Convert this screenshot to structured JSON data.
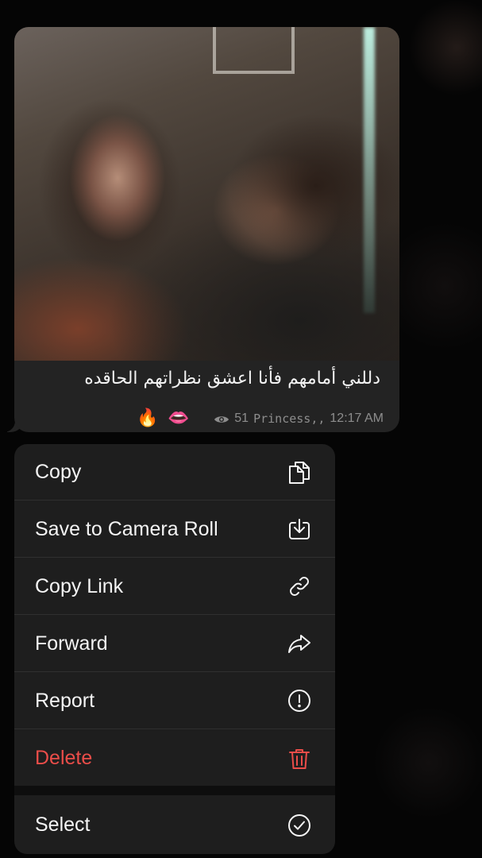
{
  "message": {
    "caption": "دللني أمامهم  فأنا اعشق نظراتهم الحاقده",
    "emojis": [
      "🔥",
      "👄"
    ],
    "views": "51",
    "author": "Princess,,",
    "time": "12:17 AM",
    "icons": {
      "views": "eye-icon"
    }
  },
  "menu": {
    "items": [
      {
        "label": "Copy",
        "icon": "copy-icon"
      },
      {
        "label": "Save to Camera Roll",
        "icon": "download-icon"
      },
      {
        "label": "Copy Link",
        "icon": "link-icon"
      },
      {
        "label": "Forward",
        "icon": "forward-icon"
      },
      {
        "label": "Report",
        "icon": "report-icon"
      },
      {
        "label": "Delete",
        "icon": "trash-icon",
        "color": "#ea4d49"
      },
      {
        "label": "Select",
        "icon": "check-circle-icon"
      }
    ]
  },
  "colors": {
    "background": "#050505",
    "bubble": "#232323",
    "menu": "#1e1e1e",
    "danger": "#ea4d49",
    "meta_text": "#8d8d8d"
  }
}
